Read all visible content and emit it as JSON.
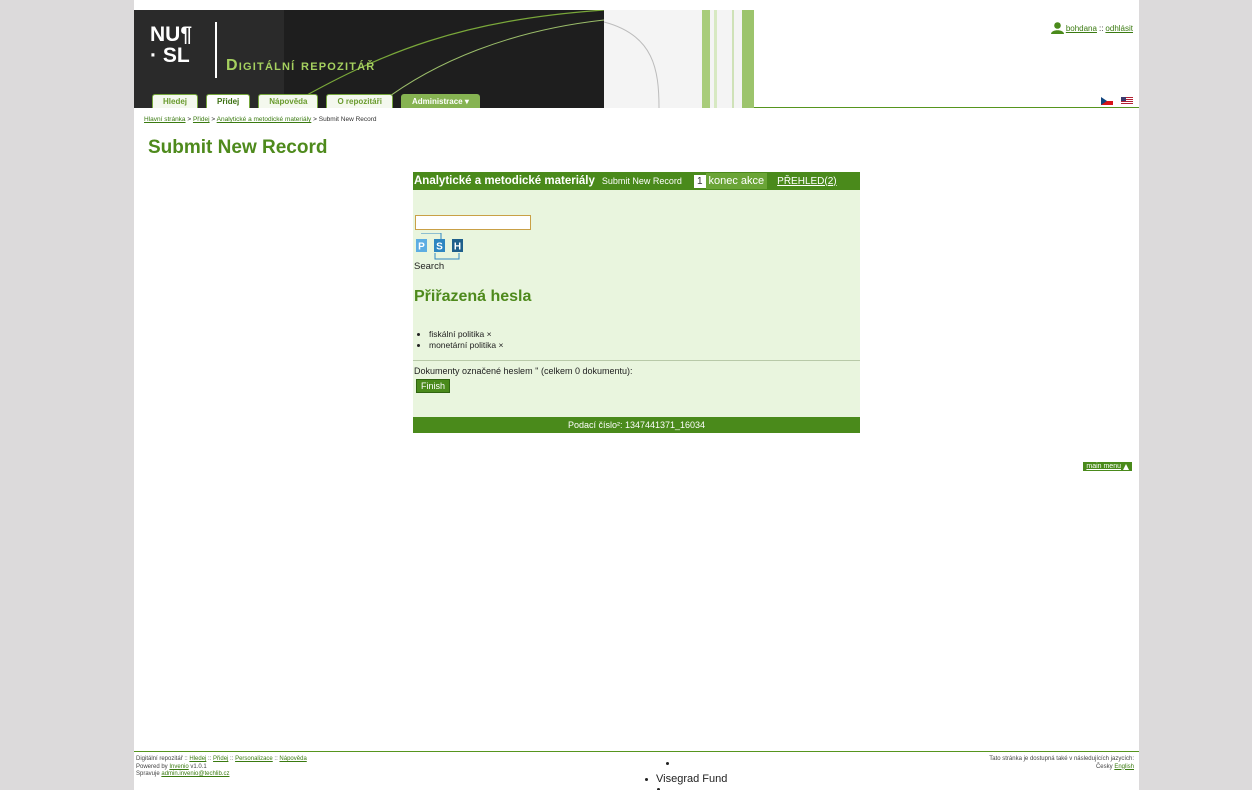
{
  "header": {
    "logo_line1": "NU¶",
    "logo_line2": "· SL",
    "site_title": "Digitální repozitář",
    "tabs": [
      "Hledej",
      "Přidej",
      "Nápověda",
      "O repozitáři",
      "Administrace"
    ],
    "active_tab": "Přidej",
    "user": {
      "name": "bohdana",
      "separator": " :: ",
      "logout": "odhlásit"
    }
  },
  "breadcrumb": {
    "items": [
      "Hlavní stránka",
      "Přidej",
      "Analytické a metodické materiály"
    ],
    "current": "Submit New Record",
    "separator": " > "
  },
  "page_title": "Submit New Record",
  "panel": {
    "doctype": "Analytické a metodické materiály",
    "action": "Submit New Record",
    "step_number": "1",
    "step_name": "konec akce",
    "summary_link": "PŘEHLED(2)",
    "search_value": "",
    "psh_letters": [
      "P",
      "S",
      "H"
    ],
    "search_label": "Search",
    "assigned_title": "Přiřazená hesla",
    "assigned": [
      "fiskální politika ×",
      "monetární politika ×"
    ],
    "docs_line": "Dokumenty označené heslem '' (celkem 0 dokumentu):",
    "finish_label": "Finish",
    "footer": "Podací číslo²: 1347441371_16034"
  },
  "main_menu": "main menu",
  "footer": {
    "left_line1_prefix": "Digitální repozitář :: ",
    "left_links": [
      "Hledej",
      "Přidej",
      "Personalizace",
      "Nápověda"
    ],
    "left_line2_prefix": "Powered by ",
    "left_line2_link": "Invenio",
    "left_line2_suffix": " v1.0.1",
    "left_line3_prefix": "Spravuje ",
    "left_line3_link": "admin.invenio@techlib.cz",
    "visegrad": "Visegrad Fund",
    "right_line1": "Tato stránka je dostupná také v následujících jazycích:",
    "right_lang_cz": "Česky",
    "right_lang_en": "English"
  },
  "colors": {
    "accent": "#4a8a1b",
    "title_green": "#4e8a1c",
    "panel_bg": "#e9f5de",
    "outer_bg": "#dcdadb"
  }
}
